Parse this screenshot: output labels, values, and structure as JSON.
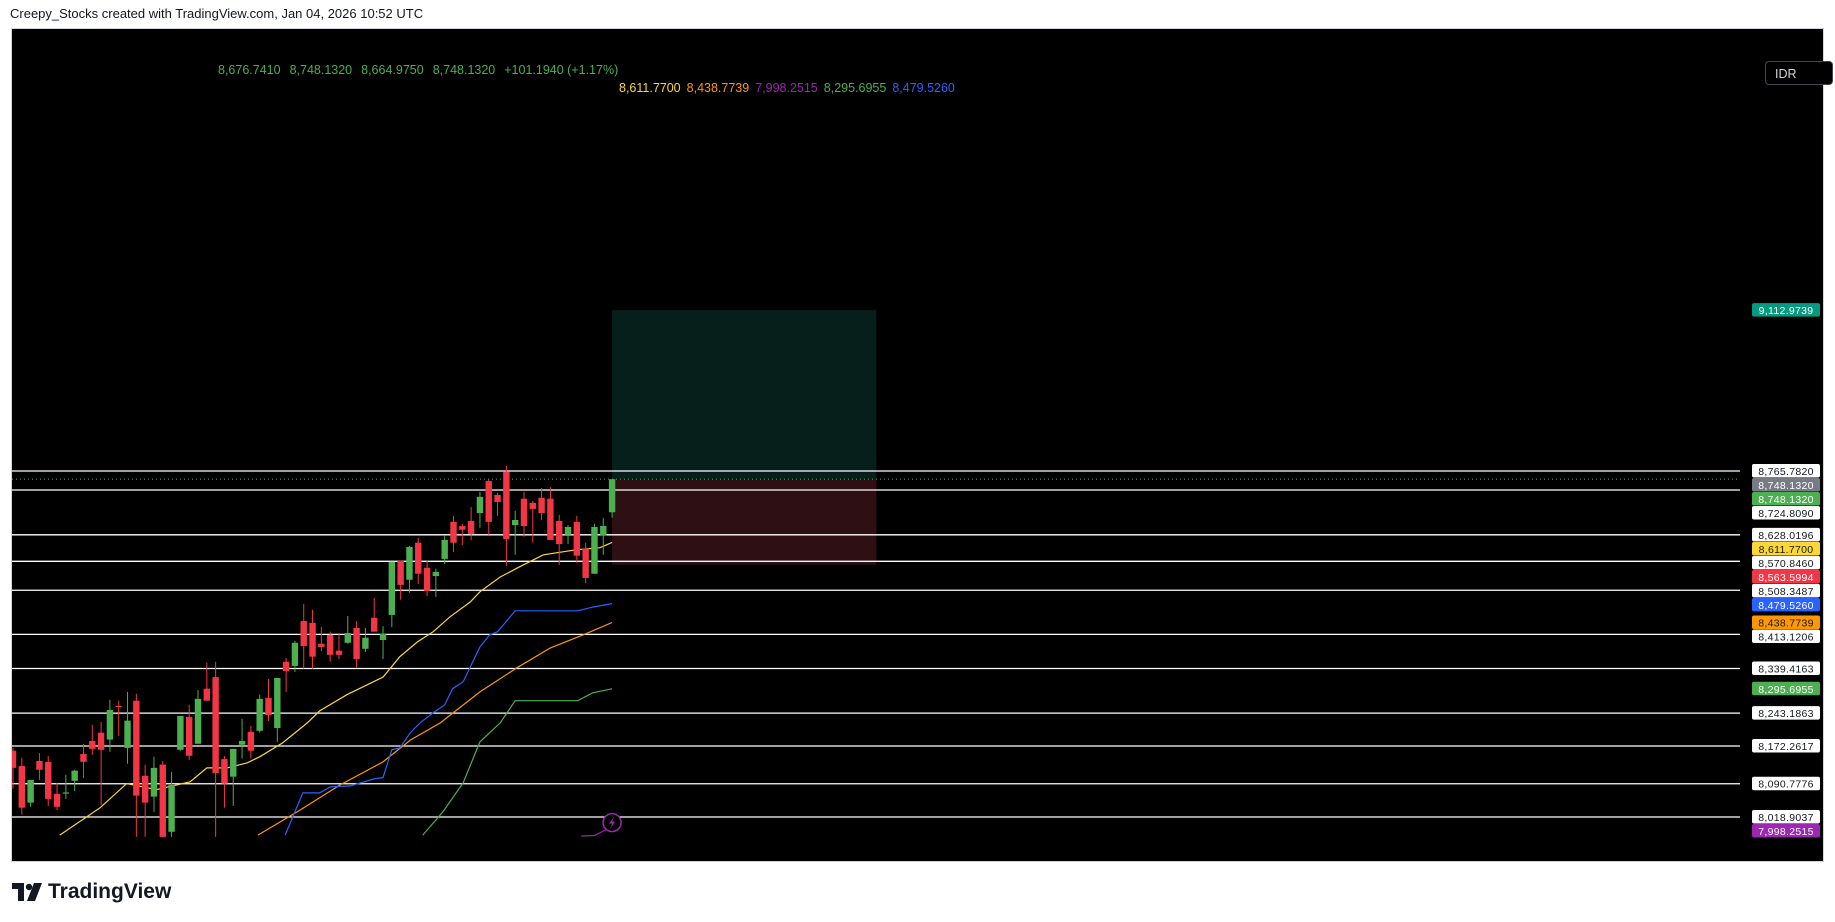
{
  "header": {
    "credit": "Creepy_Stocks created with TradingView.com, Jan 04, 2026 10:52 UTC"
  },
  "legend": {
    "ohlc": [
      "8,676.7410",
      "8,748.1320",
      "8,664.9750",
      "8,748.1320",
      "+101.1940 (+1.17%)"
    ],
    "mas": [
      {
        "value": "8,611.7700",
        "color": "#fdd835"
      },
      {
        "value": "8,438.7739",
        "color": "#ff9800"
      },
      {
        "value": "7,998.2515",
        "color": "#9c27b0"
      },
      {
        "value": "8,295.6955",
        "color": "#4caf50"
      },
      {
        "value": "8,479.5260",
        "color": "#2962ff"
      }
    ]
  },
  "currency_button": "IDR",
  "logo": {
    "text": "TradingView"
  },
  "chart_data": {
    "type": "candlestick",
    "colors": {
      "up": "#4caf50",
      "down": "#f23645"
    },
    "candles": [
      [
        8162,
        8168,
        8080,
        8125
      ],
      [
        8129,
        8147,
        8024,
        8039
      ],
      [
        8050,
        8099,
        8041,
        8099
      ],
      [
        8140,
        8157,
        8099,
        8121
      ],
      [
        8138,
        8151,
        8043,
        8058
      ],
      [
        8069,
        8093,
        8034,
        8041
      ],
      [
        8070,
        8110,
        8058,
        8072
      ],
      [
        8097,
        8121,
        8075,
        8119
      ],
      [
        8155,
        8177,
        8103,
        8138
      ],
      [
        8183,
        8218,
        8153,
        8166
      ],
      [
        8201,
        8224,
        8045,
        8164
      ],
      [
        8186,
        8272,
        8160,
        8250
      ],
      [
        8259,
        8270,
        8194,
        8257
      ],
      [
        8168,
        8289,
        8134,
        8227
      ],
      [
        8270,
        8285,
        7976,
        8065
      ],
      [
        8108,
        8132,
        7976,
        8050
      ],
      [
        8063,
        8149,
        8030,
        8125
      ],
      [
        8132,
        8140,
        7976,
        7976
      ],
      [
        7987,
        8116,
        7976,
        8088
      ],
      [
        8164,
        8237,
        8162,
        8237
      ],
      [
        8235,
        8261,
        8142,
        8151
      ],
      [
        8177,
        8293,
        8177,
        8274
      ],
      [
        8296,
        8352,
        8270,
        8270
      ],
      [
        8321,
        8354,
        7976,
        8114
      ],
      [
        8144,
        8151,
        8039,
        8091
      ],
      [
        8106,
        8166,
        8043,
        8166
      ],
      [
        8175,
        8231,
        8145,
        8183
      ],
      [
        8203,
        8216,
        8145,
        8162
      ],
      [
        8205,
        8283,
        8201,
        8274
      ],
      [
        8276,
        8317,
        8226,
        8239
      ],
      [
        8211,
        8319,
        8181,
        8319
      ],
      [
        8354,
        8362,
        8289,
        8334
      ],
      [
        8345,
        8399,
        8332,
        8395
      ],
      [
        8442,
        8479,
        8339,
        8388
      ],
      [
        8438,
        8466,
        8339,
        8365
      ],
      [
        8393,
        8429,
        8377,
        8386
      ],
      [
        8412,
        8419,
        8354,
        8369
      ],
      [
        8378,
        8416,
        8360,
        8369
      ],
      [
        8395,
        8453,
        8393,
        8416
      ],
      [
        8427,
        8442,
        8341,
        8360
      ],
      [
        8382,
        8427,
        8375,
        8406
      ],
      [
        8449,
        8492,
        8419,
        8419
      ],
      [
        8401,
        8431,
        8360,
        8414
      ],
      [
        8455,
        8570,
        8429,
        8570
      ],
      [
        8572,
        8572,
        8488,
        8520
      ],
      [
        8531,
        8604,
        8503,
        8602
      ],
      [
        8611,
        8621,
        8522,
        8544
      ],
      [
        8557,
        8572,
        8496,
        8507
      ],
      [
        8539,
        8555,
        8494,
        8548
      ],
      [
        8576,
        8626,
        8565,
        8617
      ],
      [
        8656,
        8669,
        8591,
        8611
      ],
      [
        8647,
        8652,
        8606,
        8639
      ],
      [
        8658,
        8688,
        8617,
        8630
      ],
      [
        8675,
        8721,
        8643,
        8710
      ],
      [
        8744,
        8749,
        8628,
        8656
      ],
      [
        8714,
        8719,
        8669,
        8699
      ],
      [
        8764,
        8777,
        8561,
        8619
      ],
      [
        8649,
        8680,
        8585,
        8660
      ],
      [
        8706,
        8721,
        8624,
        8647
      ],
      [
        8697,
        8701,
        8611,
        8684
      ],
      [
        8708,
        8729,
        8660,
        8675
      ],
      [
        8706,
        8731,
        8617,
        8617
      ],
      [
        8658,
        8671,
        8563,
        8608
      ],
      [
        8628,
        8649,
        8608,
        8645
      ],
      [
        8656,
        8669,
        8567,
        8583
      ],
      [
        8598,
        8611,
        8524,
        8535
      ],
      [
        8544,
        8652,
        8544,
        8645
      ],
      [
        8626,
        8664,
        8585,
        8647
      ],
      [
        8676.741,
        8748.132,
        8664.975,
        8748.132
      ]
    ],
    "moving_averages": [
      {
        "color": "#fdd835",
        "points": [
          [
            5.3,
            7980
          ],
          [
            9.9,
            8039
          ],
          [
            12.9,
            8091
          ],
          [
            16.3,
            8078
          ],
          [
            20.1,
            8095
          ],
          [
            22,
            8125
          ],
          [
            24.3,
            8125
          ],
          [
            26.6,
            8136
          ],
          [
            28,
            8149
          ],
          [
            30.6,
            8179
          ],
          [
            33.4,
            8222
          ],
          [
            34.8,
            8248
          ],
          [
            37.9,
            8283
          ],
          [
            42,
            8321
          ],
          [
            43.9,
            8365
          ],
          [
            45.9,
            8397
          ],
          [
            47.7,
            8419
          ],
          [
            49.6,
            8451
          ],
          [
            51.9,
            8483
          ],
          [
            53,
            8505
          ],
          [
            55.3,
            8537
          ],
          [
            57.5,
            8559
          ],
          [
            60.2,
            8585
          ],
          [
            64,
            8596
          ],
          [
            66.6,
            8600
          ],
          [
            68,
            8611.77
          ]
        ]
      },
      {
        "color": "#ff9800",
        "points": [
          [
            27.8,
            7980
          ],
          [
            32.6,
            8034
          ],
          [
            37.1,
            8088
          ],
          [
            42,
            8138
          ],
          [
            45.1,
            8185
          ],
          [
            48.5,
            8222
          ],
          [
            53,
            8289
          ],
          [
            57.2,
            8341
          ],
          [
            61,
            8384
          ],
          [
            64.7,
            8412
          ],
          [
            68,
            8438.77
          ]
        ]
      },
      {
        "color": "#2962ff",
        "points": [
          [
            30.9,
            7980
          ],
          [
            32.9,
            8071
          ],
          [
            34.8,
            8071
          ],
          [
            36,
            8084
          ],
          [
            38.3,
            8086
          ],
          [
            40.9,
            8101
          ],
          [
            42,
            8104
          ],
          [
            43,
            8164
          ],
          [
            43.9,
            8168
          ],
          [
            45.1,
            8201
          ],
          [
            46.2,
            8222
          ],
          [
            47.7,
            8244
          ],
          [
            49,
            8261
          ],
          [
            49.9,
            8296
          ],
          [
            51.1,
            8311
          ],
          [
            53,
            8386
          ],
          [
            54.1,
            8412
          ],
          [
            55,
            8419
          ],
          [
            57,
            8464
          ],
          [
            64.1,
            8464
          ],
          [
            65.8,
            8472
          ],
          [
            68,
            8479.53
          ]
        ]
      },
      {
        "color": "#4caf50",
        "points": [
          [
            46.5,
            7980
          ],
          [
            48.8,
            8030
          ],
          [
            51.1,
            8093
          ],
          [
            53,
            8181
          ],
          [
            55.3,
            8222
          ],
          [
            57,
            8270
          ],
          [
            64.1,
            8270
          ],
          [
            65.8,
            8287
          ],
          [
            68,
            8295.7
          ]
        ]
      },
      {
        "color": "#9c27b0",
        "points": [
          [
            64.5,
            7978
          ],
          [
            66,
            7979
          ],
          [
            68,
            7998.25
          ]
        ]
      }
    ],
    "position_tool": {
      "target": 9112.9739,
      "entry": 8748.132,
      "stop": 8563.5994,
      "start_index": 68,
      "end_index": 98
    },
    "horizontal_lines": [
      8765.782,
      8724.809,
      8628.0196,
      8570.846,
      8508.3487,
      8413.1206,
      8339.4163,
      8243.1863,
      8172.2617,
      8090.7776,
      8018.9037
    ],
    "current_price_line": 8748.132,
    "price_labels": [
      {
        "text": "9,112.9739",
        "price": 9112.9739,
        "bg": "#089981",
        "fg": "#ffffff"
      },
      {
        "text": "8,765.7820",
        "price": 8765.782,
        "bg": "#ffffff",
        "fg": "#131722"
      },
      {
        "text": "8,748.1320",
        "price": 8748.132,
        "bg": "#787b86",
        "fg": "#ffffff"
      },
      {
        "text": "8,748.1320",
        "price": 8748.131,
        "bg": "#4caf50",
        "fg": "#ffffff"
      },
      {
        "text": "8,724.8090",
        "price": 8724.809,
        "bg": "#ffffff",
        "fg": "#131722"
      },
      {
        "text": "8,628.0196",
        "price": 8628.0196,
        "bg": "#ffffff",
        "fg": "#131722"
      },
      {
        "text": "8,611.7700",
        "price": 8611.77,
        "bg": "#fdd835",
        "fg": "#131722"
      },
      {
        "text": "8,570.8460",
        "price": 8570.846,
        "bg": "#ffffff",
        "fg": "#131722"
      },
      {
        "text": "8,563.5994",
        "price": 8563.5994,
        "bg": "#f23645",
        "fg": "#ffffff"
      },
      {
        "text": "8,508.3487",
        "price": 8508.3487,
        "bg": "#ffffff",
        "fg": "#131722"
      },
      {
        "text": "8,479.5260",
        "price": 8479.526,
        "bg": "#2962ff",
        "fg": "#ffffff"
      },
      {
        "text": "8,438.7739",
        "price": 8438.7739,
        "bg": "#ff9800",
        "fg": "#131722"
      },
      {
        "text": "8,413.1206",
        "price": 8413.1206,
        "bg": "#ffffff",
        "fg": "#131722"
      },
      {
        "text": "8,339.4163",
        "price": 8339.4163,
        "bg": "#ffffff",
        "fg": "#131722"
      },
      {
        "text": "8,295.6955",
        "price": 8295.6955,
        "bg": "#4caf50",
        "fg": "#ffffff"
      },
      {
        "text": "8,243.1863",
        "price": 8243.1863,
        "bg": "#ffffff",
        "fg": "#131722"
      },
      {
        "text": "8,172.2617",
        "price": 8172.2617,
        "bg": "#ffffff",
        "fg": "#131722"
      },
      {
        "text": "8,090.7776",
        "price": 8090.7776,
        "bg": "#ffffff",
        "fg": "#131722"
      },
      {
        "text": "8,018.9037",
        "price": 8018.9037,
        "bg": "#ffffff",
        "fg": "#131722"
      },
      {
        "text": "7,998.2515",
        "price": 7998.2515,
        "bg": "#9c27b0",
        "fg": "#ffffff"
      }
    ]
  }
}
